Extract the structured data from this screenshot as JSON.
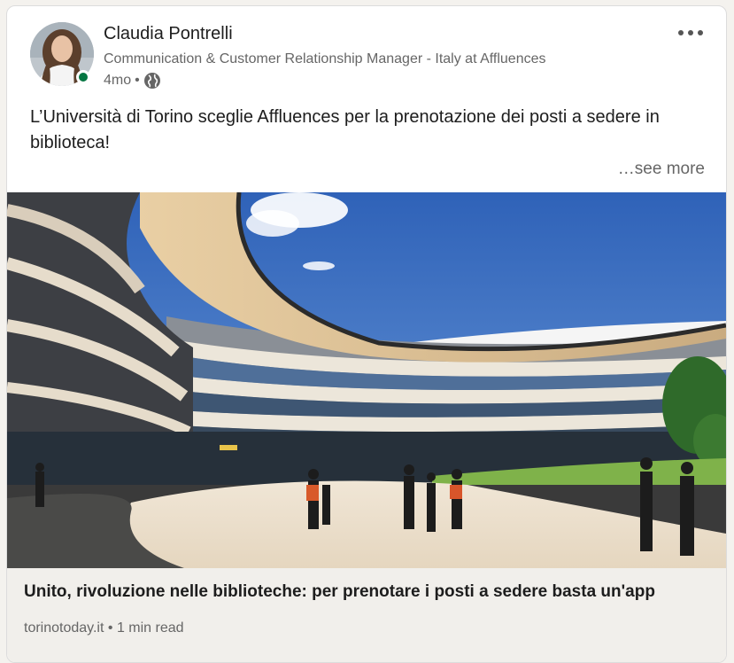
{
  "author": {
    "name": "Claudia Pontrelli",
    "headline": "Communication & Customer Relationship Manager - Italy at Affluences",
    "time": "4mo",
    "separator": "•",
    "visibility_icon": "globe-icon"
  },
  "post": {
    "text": "L’Università di Torino sceglie Affluences per la prenotazione dei posti a sedere in biblioteca!",
    "see_more": "…see more"
  },
  "menu": {
    "icon": "more-horizontal-icon"
  },
  "link_preview": {
    "title": "Unito, rivoluzione nelle biblioteche: per prenotare i posti a sedere basta un'app",
    "source": "torinotoday.it",
    "separator": "•",
    "read_time": "1 min read"
  },
  "colors": {
    "presence": "#057642",
    "text_primary": "#1d1d1d",
    "text_secondary": "#666666",
    "sky": "#3f78c8"
  }
}
